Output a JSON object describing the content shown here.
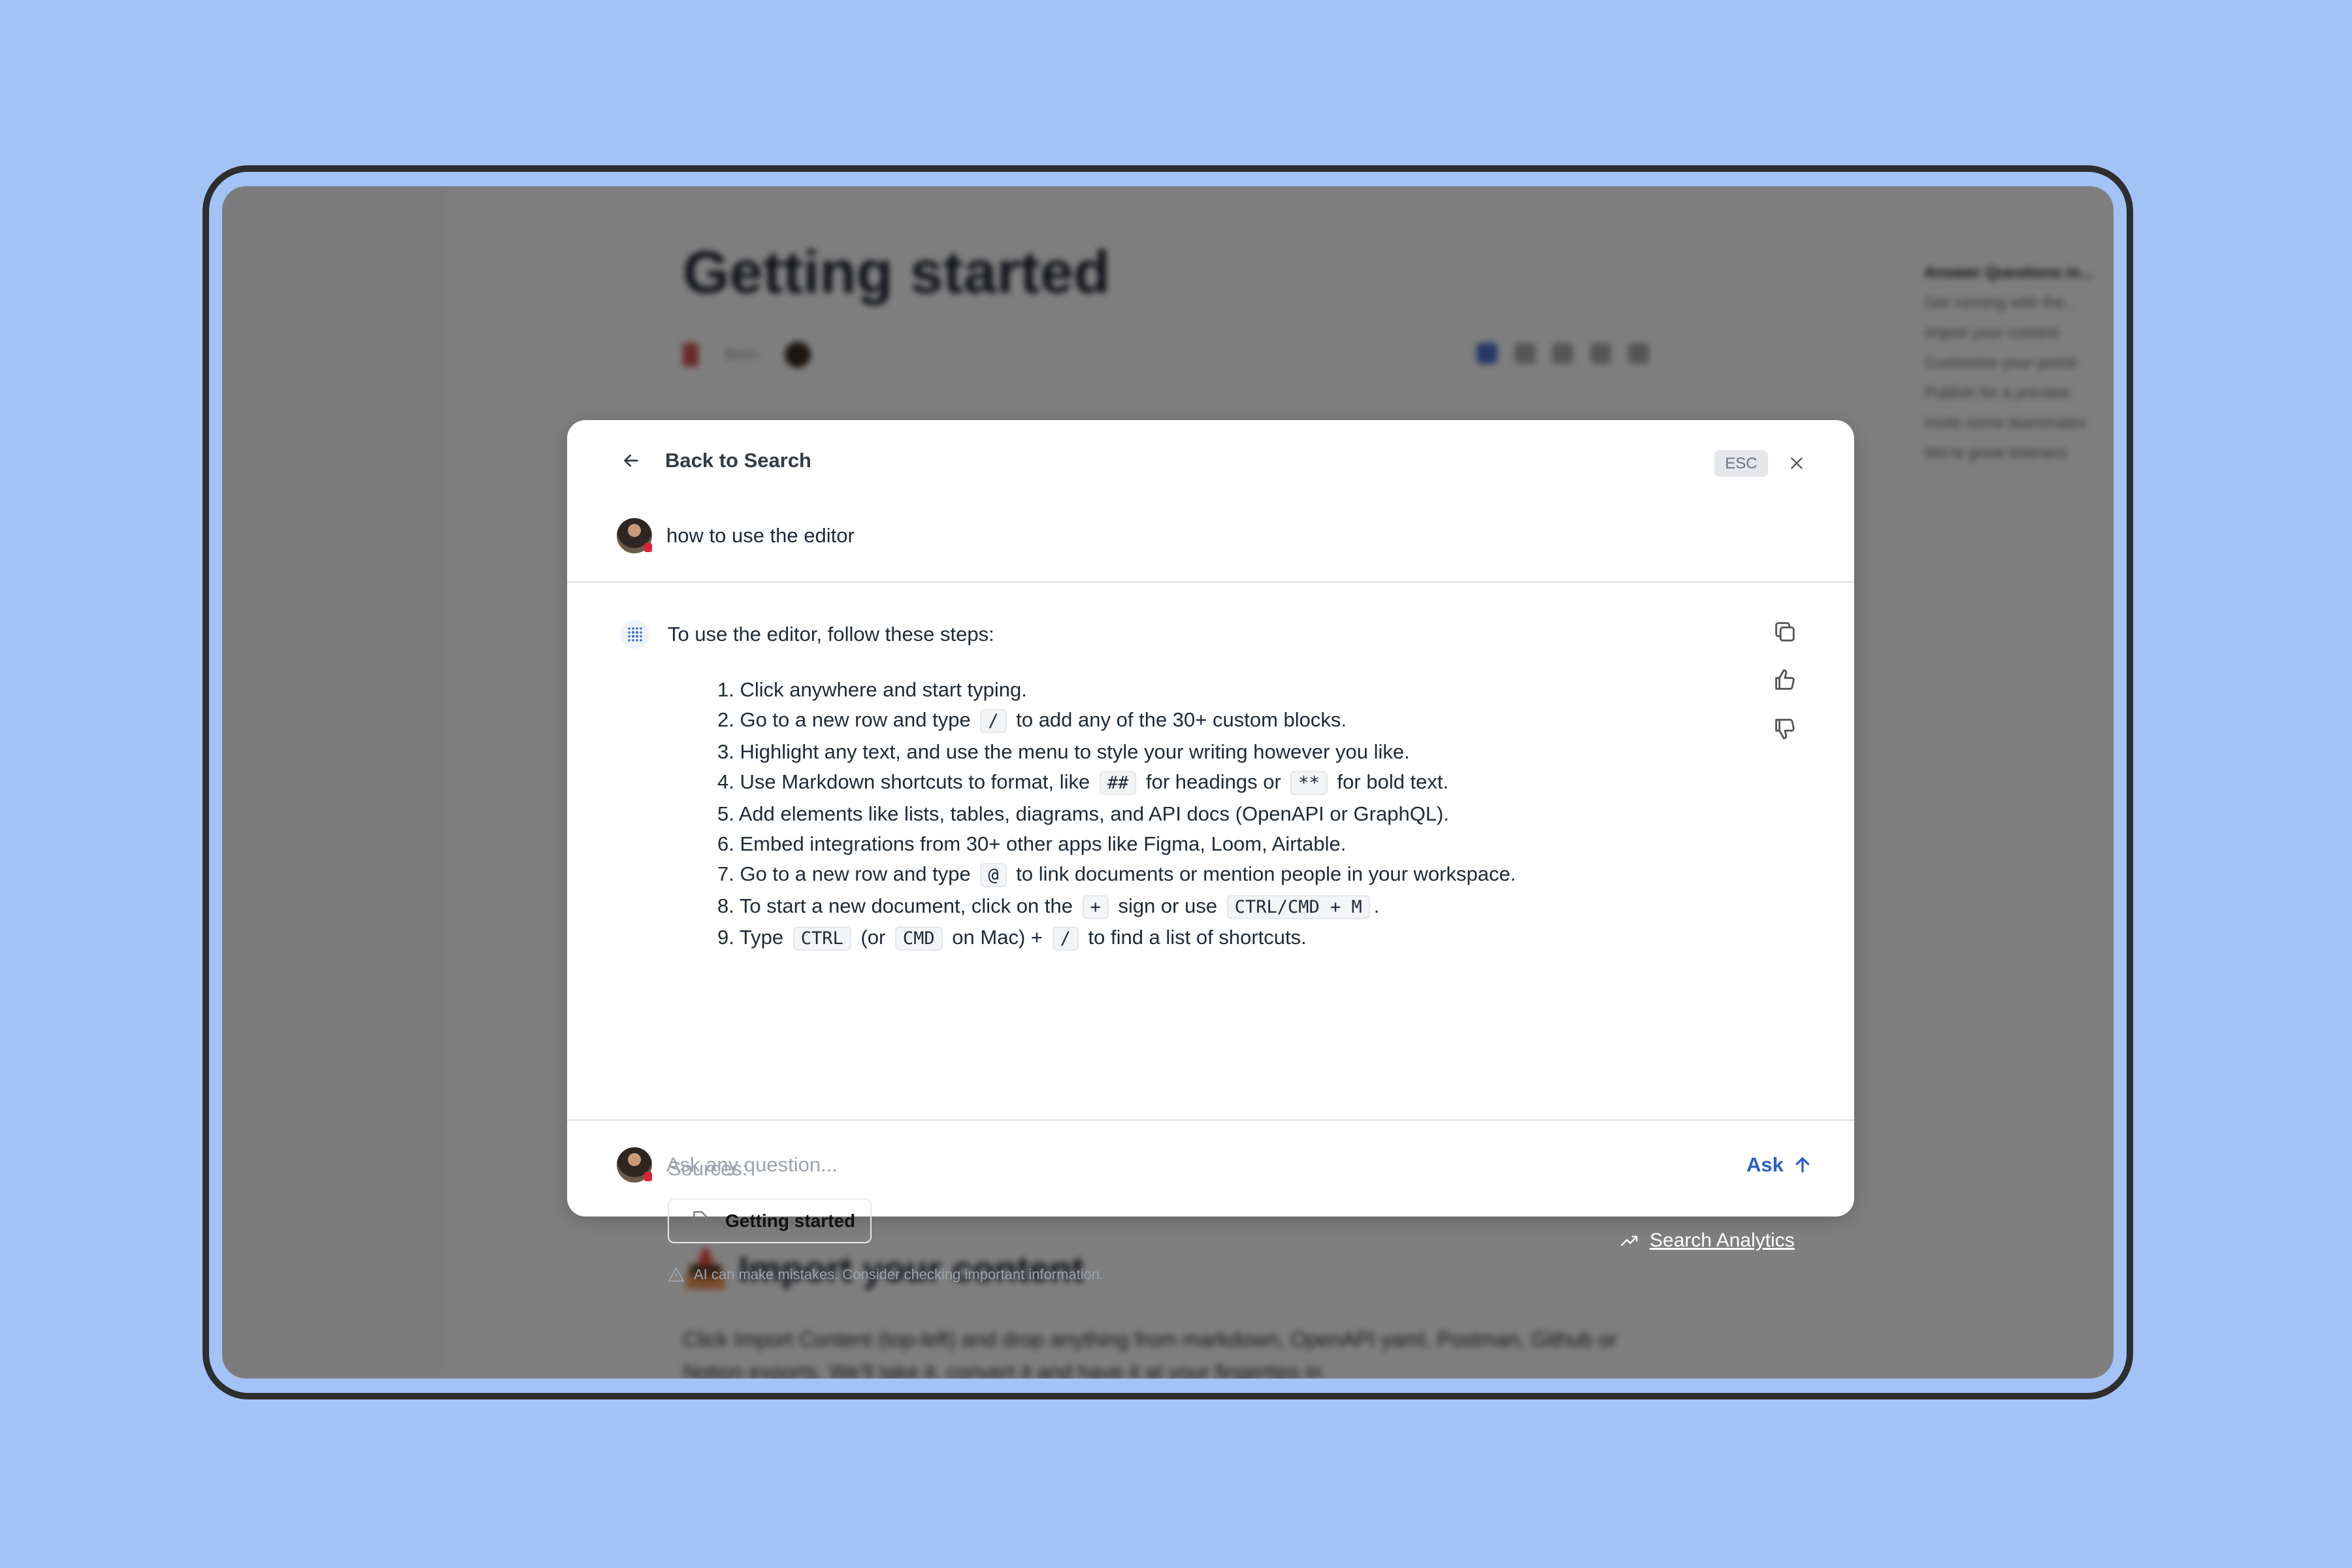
{
  "background_page": {
    "title": "Getting started",
    "meta_time": "8min",
    "toc": [
      "Answer Questions in...",
      "Get running with the...",
      "Import your content",
      "Customize your portal",
      "Publish for a preview",
      "Invite some teammates",
      "We're great listeners"
    ],
    "section_heading": "Import your content",
    "section_text": "Click Import Content (top-left) and drop anything from markdown, OpenAPI yaml, Postman, Github or Notion exports. We'll take it, convert it and have it at your fingertips in"
  },
  "modal": {
    "back_label": "Back to Search",
    "esc_label": "ESC",
    "query": "how to use the editor",
    "answer_intro": "To use the editor, follow these steps:",
    "steps": [
      {
        "parts": [
          "1. Click anywhere and start typing."
        ]
      },
      {
        "parts": [
          "2. Go to a new row and type ",
          "/",
          " to add any of the 30+ custom blocks."
        ]
      },
      {
        "parts": [
          "3. Highlight any text, and use the menu to style your writing however you like."
        ]
      },
      {
        "parts": [
          "4. Use Markdown shortcuts to format, like ",
          "##",
          " for headings or ",
          "**",
          " for bold text."
        ]
      },
      {
        "parts": [
          "5. Add elements like lists, tables, diagrams, and API docs (OpenAPI or GraphQL)."
        ]
      },
      {
        "parts": [
          "6. Embed integrations from 30+ other apps like Figma, Loom, Airtable."
        ]
      },
      {
        "parts": [
          "7. Go to a new row and type ",
          "@",
          " to link documents or mention people in your workspace."
        ]
      },
      {
        "parts": [
          "8. To start a new document, click on the ",
          "+",
          " sign or use ",
          "CTRL/CMD + M",
          "."
        ]
      },
      {
        "parts": [
          "9. Type ",
          "CTRL",
          " (or ",
          "CMD",
          " on Mac) + ",
          "/",
          " to find a list of shortcuts."
        ]
      }
    ],
    "sources_label": "Sources:",
    "source_chip": "Getting started",
    "disclaimer": "AI can make mistakes. Consider checking important information.",
    "ask_placeholder": "Ask any question...",
    "ask_label": "Ask"
  },
  "search_analytics_label": "Search Analytics",
  "colors": {
    "background": "#a3c3f7",
    "accent": "#2b5fc7",
    "overlay": "rgba(0,0,0,0.5)"
  }
}
